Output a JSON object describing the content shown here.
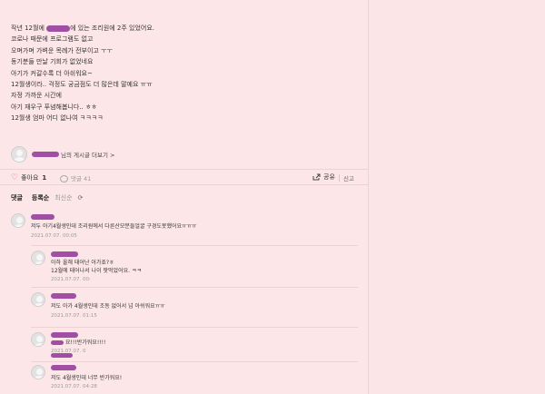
{
  "post": {
    "lines": [
      {
        "before": "작년 12월에 ",
        "redact": true,
        "after": "에 있는 조리원에 2주 있었어요."
      },
      {
        "text": "코로나 때문에 프로그램도 없고"
      },
      {
        "text": "오며가며 가벼운 목례가 전부이고 ㅜㅜ"
      },
      {
        "text": "동기분들 만날 기회가 없었네요"
      },
      {
        "text": "아기가 커갈수록 더 아쉬워요~"
      },
      {
        "text": "12월생이라.. 걱정도 궁금점도 더 많은데 말예요 ㅠㅠ"
      },
      {
        "text": "자정 가까운 시간에"
      },
      {
        "text": "아기 재우구 푸념해봅니다.. ㅎㅎ"
      },
      {
        "text": "12월생 엄마 어디 없나여 ㅋㅋㅋㅋ"
      }
    ],
    "author_more": "님의 게시글 더보기 >"
  },
  "actions": {
    "like_label": "좋아요",
    "like_count": "1",
    "comment_label": "댓글 41",
    "share_label": "공유",
    "report_label": "신고"
  },
  "comments_header": {
    "title": "댓글",
    "sort_active": "등록순",
    "sort_other": "최신순"
  },
  "comments": [
    {
      "text": "저두 아기4월생인데 조리원에서 다른산모분들얼굴 구경도못했어요ㅠㅠㅠ",
      "date": "2021.07.07. 00:05"
    },
    {
      "text": "아하 올해 태어난 아가죠?ㅎ",
      "text2": "12월에 태어나서 나이 팟먹었어요. ㅋㅋ",
      "date": "2021.07.07. 00:"
    },
    {
      "text": "저도 아가 4월생인데 조동 없어서 넘 아쉬워요ㅠㅠ",
      "date": "2021.07.07. 01:15"
    },
    {
      "text": "요!!!반가워요!!!!",
      "date": "2021.07.07. 0"
    },
    {
      "text": "저도 4월생인데 너무 반가워요!",
      "date": "2021.07.07. 04:28"
    }
  ],
  "colors": {
    "background": "#fde6e8",
    "redaction": "#a04fa4",
    "heart": "#e85a6e"
  }
}
